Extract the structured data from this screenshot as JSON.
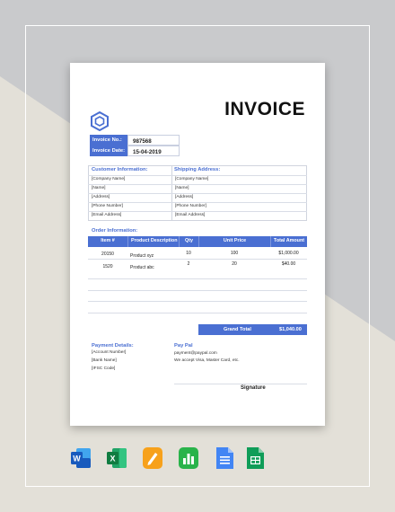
{
  "invoice": {
    "title": "INVOICE",
    "invoice_no_label": "Invoice No.:",
    "invoice_no": "987568",
    "invoice_date_label": "Invoice Date:",
    "invoice_date": "15-04-2019"
  },
  "customer": {
    "heading": "Customer Information:",
    "lines": [
      "[Company Name]",
      "[Name]",
      "[Address]",
      "[Phone Number]",
      "[Email Address]"
    ]
  },
  "shipping": {
    "heading": "Shipping Address:",
    "lines": [
      "[Company Name]",
      "[Name]",
      "[Address]",
      "[Phone Number]",
      "[Email Address]"
    ]
  },
  "order": {
    "heading": "Order Information:",
    "headers": [
      "Item #",
      "Product Description",
      "Qty",
      "Unit Price",
      "Total Amount"
    ],
    "rows": [
      {
        "item": "20150",
        "desc": "Product xyz",
        "qty": "10",
        "unit": "100",
        "total": "$1,000.00"
      },
      {
        "item": "1520",
        "desc": "Product abc",
        "qty": "2",
        "unit": "20",
        "total": "$40.00"
      }
    ],
    "grand_total_label": "Grand Total",
    "grand_total": "$1,040.00"
  },
  "payment": {
    "heading": "Payment Details:",
    "lines": [
      "[Account Number]",
      "[Bank Name]",
      "[IFSC Code]"
    ]
  },
  "paypal": {
    "heading": "Pay Pal",
    "lines": [
      "payment@paypal.com",
      "We accept Visa, Master Card, etc."
    ]
  },
  "signature_label": "Signature",
  "colors": {
    "accent": "#4a6fd2"
  },
  "format_icons": [
    "word-icon",
    "excel-icon",
    "pages-icon",
    "numbers-icon",
    "google-docs-icon",
    "google-sheets-icon"
  ]
}
